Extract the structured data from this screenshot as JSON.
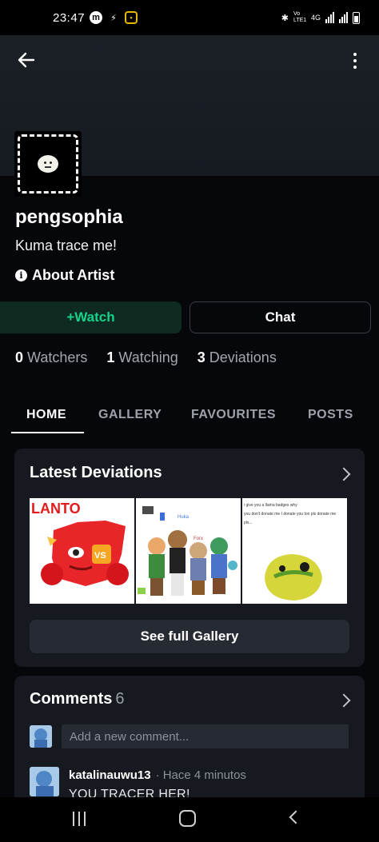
{
  "status_bar": {
    "time": "23:47",
    "network": "4G",
    "volte": "Vo LTE1"
  },
  "profile": {
    "username": "pengsophia",
    "tagline": "Kuma trace me!",
    "about_label": "About Artist"
  },
  "actions": {
    "watch_label": "+Watch",
    "chat_label": "Chat"
  },
  "stats": [
    {
      "count": "0",
      "label": "Watchers"
    },
    {
      "count": "1",
      "label": "Watching"
    },
    {
      "count": "3",
      "label": "Deviations"
    }
  ],
  "tabs": [
    {
      "label": "HOME",
      "active": true
    },
    {
      "label": "GALLERY",
      "active": false
    },
    {
      "label": "FAVOURITES",
      "active": false
    },
    {
      "label": "POSTS",
      "active": false
    }
  ],
  "latest": {
    "title": "Latest Deviations",
    "thumbnails": [
      {
        "label": "LANTO",
        "badge": "VS"
      },
      {
        "label": "Forx",
        "label2": "Huka"
      },
      {
        "caption": "i give you a llama badges why you don't donate me I donate you too pls donate me pls..."
      }
    ],
    "see_full_label": "See full Gallery"
  },
  "comments": {
    "title": "Comments",
    "count": "6",
    "placeholder": "Add a new comment...",
    "items": [
      {
        "user": "katalinauwu13",
        "time": "· Hace 4 minutos",
        "text": "YOU TRACER HER!"
      }
    ]
  },
  "colors": {
    "background": "#06070a",
    "banner": "#1b1f26",
    "card": "#16191f",
    "watch_bg": "#0e2a21",
    "watch_text": "#15d38b"
  }
}
